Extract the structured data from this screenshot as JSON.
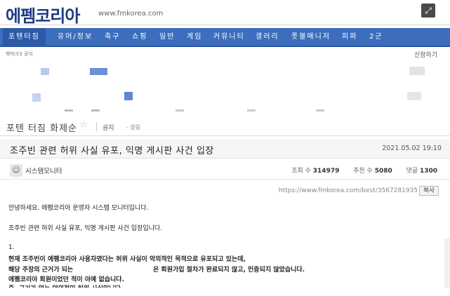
{
  "header": {
    "logo_text": "에펨코리아",
    "logo_url": "www.fmkorea.com",
    "expand_icon": "expand-icon"
  },
  "nav": {
    "items": [
      {
        "label": "포텐터짐"
      },
      {
        "label": "유머/정보"
      },
      {
        "label": "축구"
      },
      {
        "label": "쇼핑"
      },
      {
        "label": "일반"
      },
      {
        "label": "게임"
      },
      {
        "label": "커뮤니티"
      },
      {
        "label": "갤러리"
      },
      {
        "label": "풋볼매니저"
      },
      {
        "label": "피파"
      },
      {
        "label": "2군"
      }
    ]
  },
  "subbar": {
    "left_text": "북마크3 공지",
    "right_text": "신청하기"
  },
  "board": {
    "title": "포텐 터짐 화제순",
    "star_icon": "star-icon",
    "notice_label": "공지",
    "notice_alarm": "- 알림"
  },
  "post": {
    "title": "조주빈 관련 허위 사실 유포, 익명 게시판 사건 입장",
    "date": "2021.05.02 19:10",
    "author": "시스템모니터",
    "views_label": "조회 수",
    "views": "314979",
    "recommend_label": "추천 수",
    "recommend": "5080",
    "comments_label": "댓글",
    "comments": "1300",
    "url": "https://www.fmkorea.com/best/3567281935",
    "copy_label": "복사"
  },
  "body": {
    "lines": [
      {
        "text": "안녕하세요. 에펨코리아 운영자 시스템 모니터입니다."
      },
      {
        "text": "조주빈 관련 허위 사실 유포, 익명 게시판 사건 입장입니다."
      },
      {
        "text": "1."
      },
      {
        "text": "현재 조주빈이 에펨코리아 사용자였다는 허위 사실이 악의적인 목적으로 유포되고 있는데,"
      },
      {
        "text": "해당 주장의 근거가 되는"
      },
      {
        "text": "은 회원가입 절차가 완료되지 않고, 인증되지 않았습니다."
      },
      {
        "text": "에펨코리아 회원이었던 적이 아예 없습니다."
      },
      {
        "text": "즉, 근거가 없는 악의적인 허위 사실입니다."
      }
    ]
  }
}
